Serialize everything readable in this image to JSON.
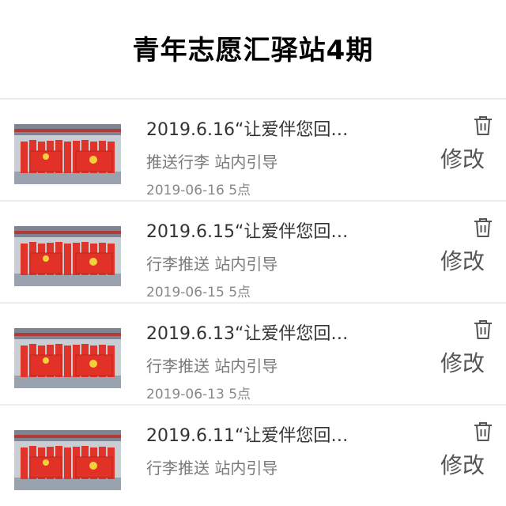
{
  "header": {
    "title": "青年志愿汇驿站4期"
  },
  "icons": {
    "delete": "trash-icon"
  },
  "items": [
    {
      "title": "2019.6.16“让爱伴您回…",
      "tags": "推送行李 站内引导",
      "date": "2019-06-16 5点",
      "edit_label": "修改"
    },
    {
      "title": "2019.6.15“让爱伴您回…",
      "tags": "行李推送 站内引导",
      "date": "2019-06-15 5点",
      "edit_label": "修改"
    },
    {
      "title": "2019.6.13“让爱伴您回…",
      "tags": "行李推送 站内引导",
      "date": "2019-06-13 5点",
      "edit_label": "修改"
    },
    {
      "title": "2019.6.11“让爱伴您回…",
      "tags": "行李推送 站内引导",
      "date": "",
      "edit_label": "修改"
    }
  ],
  "colors": {
    "banner_red": "#e0342a",
    "text_dark": "#333333",
    "text_muted": "#888888"
  }
}
